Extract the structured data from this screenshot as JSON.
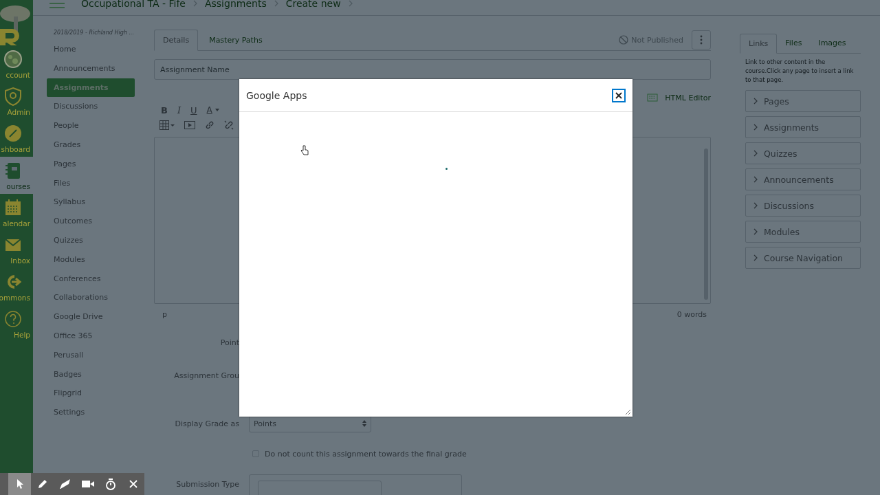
{
  "global_nav": {
    "items": [
      {
        "label": "ccount",
        "kind": "avatar",
        "selected": false
      },
      {
        "label": "Admin",
        "kind": "shield",
        "selected": false
      },
      {
        "label": "shboard",
        "kind": "gauge",
        "selected": false
      },
      {
        "label": "ourses",
        "kind": "book",
        "selected": true
      },
      {
        "label": "alendar",
        "kind": "calendar",
        "selected": false
      },
      {
        "label": "Inbox",
        "kind": "inbox",
        "selected": false
      },
      {
        "label": "ommons",
        "kind": "commons",
        "selected": false
      },
      {
        "label": "Help",
        "kind": "help",
        "selected": false
      }
    ]
  },
  "breadcrumb": [
    "Occupational TA - Fife",
    "Assignments",
    "Create new"
  ],
  "course_nav": {
    "term": "2018/2019 - Richland High ...",
    "items": [
      {
        "label": "Home",
        "selected": false
      },
      {
        "label": "Announcements",
        "selected": false
      },
      {
        "label": "Assignments",
        "selected": true
      },
      {
        "label": "Discussions",
        "selected": false
      },
      {
        "label": "People",
        "selected": false
      },
      {
        "label": "Grades",
        "selected": false
      },
      {
        "label": "Pages",
        "selected": false
      },
      {
        "label": "Files",
        "selected": false
      },
      {
        "label": "Syllabus",
        "selected": false
      },
      {
        "label": "Outcomes",
        "selected": false
      },
      {
        "label": "Quizzes",
        "selected": false
      },
      {
        "label": "Modules",
        "selected": false
      },
      {
        "label": "Conferences",
        "selected": false
      },
      {
        "label": "Collaborations",
        "selected": false
      },
      {
        "label": "Google Drive",
        "selected": false
      },
      {
        "label": "Office 365",
        "selected": false
      },
      {
        "label": "Perusall",
        "selected": false
      },
      {
        "label": "Badges",
        "selected": false
      },
      {
        "label": "Flipgrid",
        "selected": false
      },
      {
        "label": "Settings",
        "selected": false
      }
    ]
  },
  "tabs": [
    {
      "label": "Details",
      "selected": true
    },
    {
      "label": "Mastery Paths",
      "selected": false
    }
  ],
  "publish_status": "Not Published",
  "assignment_name": {
    "placeholder": "Assignment Name"
  },
  "editor": {
    "format_buttons": [
      {
        "kind": "bold",
        "label": "B"
      },
      {
        "kind": "italic",
        "label": "I"
      },
      {
        "kind": "underline",
        "label": "U"
      },
      {
        "kind": "color",
        "label": "A"
      }
    ],
    "html_editor": "HTML Editor",
    "path": "p",
    "word_count": "0 words"
  },
  "form": {
    "points_label": "Point",
    "group_label": "Assignment Grou",
    "display_grade": {
      "label": "Display Grade as",
      "value": "Points"
    },
    "exclude": {
      "label": "Do not count this assignment towards the final grade",
      "checked": false
    },
    "submission_label": "Submission Type"
  },
  "sidebar": {
    "tabs": [
      {
        "label": "Links",
        "selected": true
      },
      {
        "label": "Files",
        "selected": false
      },
      {
        "label": "Images",
        "selected": false
      }
    ],
    "hint": "Link to other content in the course.Click any page to insert a link to that page.",
    "sections": [
      {
        "label": "Pages",
        "expanded": false
      },
      {
        "label": "Assignments",
        "expanded": false
      },
      {
        "label": "Quizzes",
        "expanded": false
      },
      {
        "label": "Announcements",
        "expanded": false
      },
      {
        "label": "Discussions",
        "expanded": false
      },
      {
        "label": "Modules",
        "expanded": false
      },
      {
        "label": "Course Navigation",
        "expanded": false
      }
    ]
  },
  "modal": {
    "title": "Google Apps"
  },
  "recorder_tools": [
    {
      "kind": "pointer",
      "selected": true
    },
    {
      "kind": "pen",
      "selected": false
    },
    {
      "kind": "eraser",
      "selected": false
    },
    {
      "kind": "camera",
      "selected": false
    },
    {
      "kind": "timer",
      "selected": false
    },
    {
      "kind": "close",
      "selected": false
    }
  ]
}
